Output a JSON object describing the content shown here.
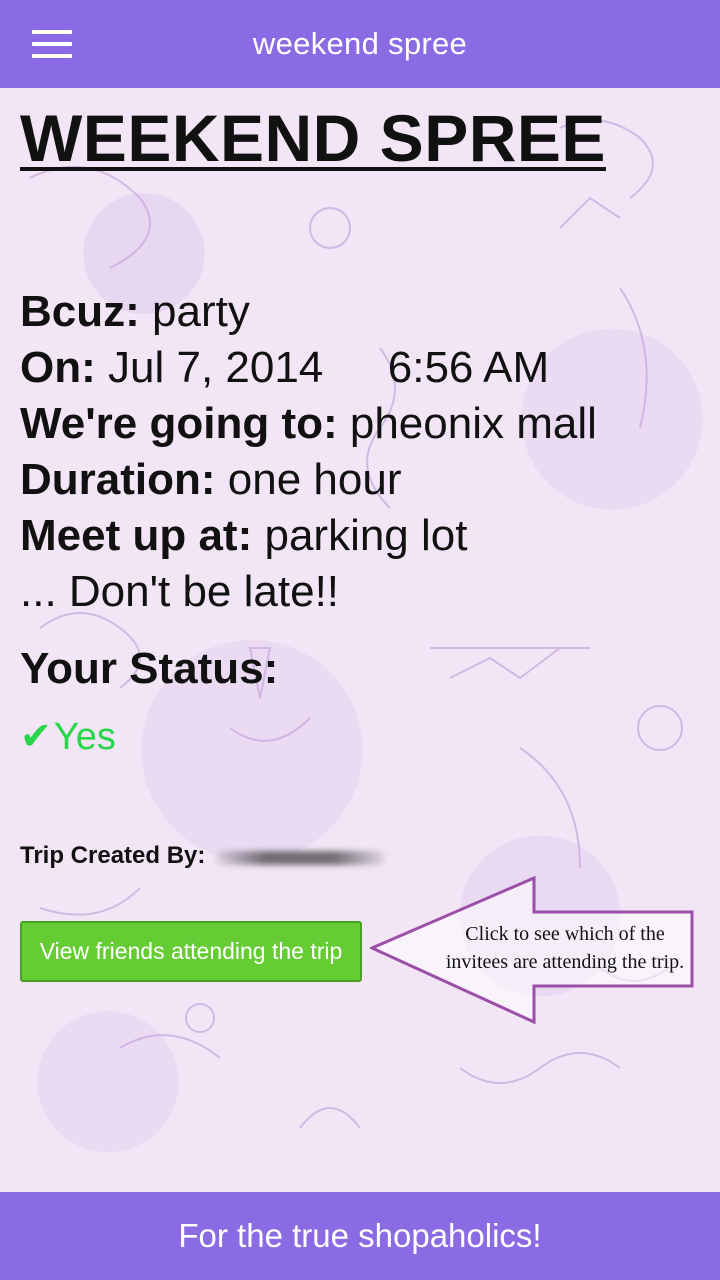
{
  "header": {
    "app_title": "weekend spree",
    "menu_icon": "hamburger-menu-icon"
  },
  "trip": {
    "title": "WEEKEND SPREE",
    "reason_label": "Bcuz:",
    "reason_value": "party",
    "date_label": "On:",
    "date_value": "Jul 7, 2014",
    "time_value": "6:56 AM",
    "destination_label": "We're going to:",
    "destination_value": "pheonix mall",
    "duration_label": "Duration:",
    "duration_value": "one hour",
    "meetup_label": "Meet up at:",
    "meetup_value": "parking lot",
    "note": "... Don't be late!!"
  },
  "status": {
    "label": "Your Status:",
    "check_glyph": "✔",
    "value": "Yes",
    "color": "#29d64a"
  },
  "creator": {
    "label": "Trip Created By:"
  },
  "actions": {
    "view_friends_label": "View friends attending the trip",
    "button_color": "#66cc33"
  },
  "callout": {
    "text": "Click to see which of the invitees are attending the trip.",
    "border_color": "#9b4fa8"
  },
  "footer": {
    "tagline": "For the true shopaholics!"
  },
  "colors": {
    "bar": "#8a6be3"
  }
}
